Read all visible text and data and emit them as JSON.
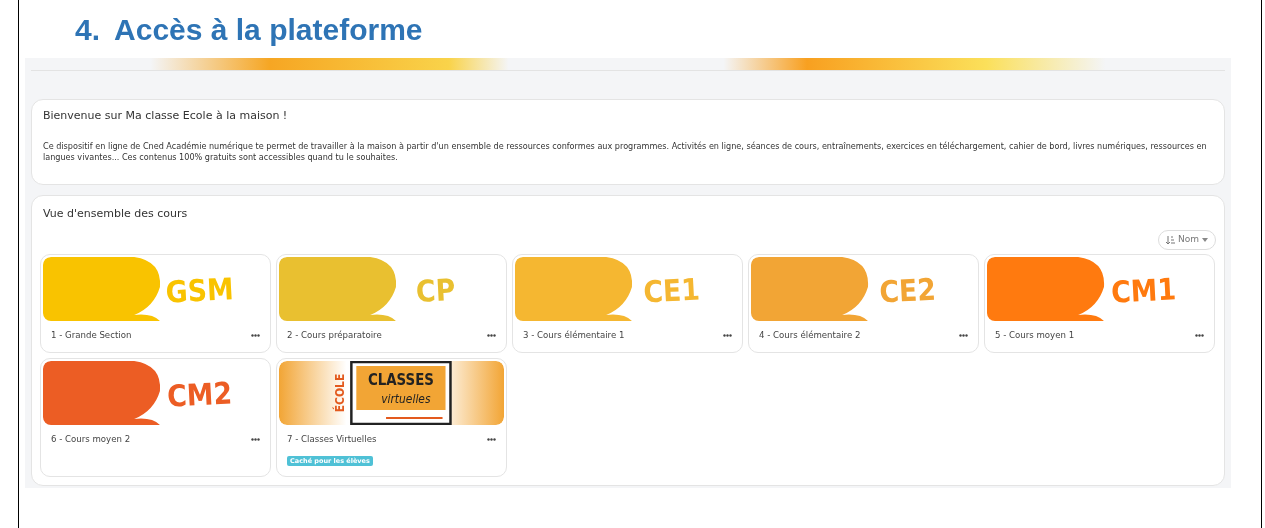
{
  "heading": {
    "number": "4.",
    "title": "Accès à la plateforme"
  },
  "welcome": {
    "title": "Bienvenue sur Ma classe Ecole à la maison !",
    "text": "Ce dispositif en ligne de Cned Académie numérique te permet de travailler à la maison à partir d'un ensemble de ressources conformes aux programmes. Activités en ligne, séances de cours, entraînements, exercices en téléchargement, cahier de bord, livres numériques, ressources en langues vivantes... Ces contenus 100% gratuits sont accessibles quand tu le souhaites."
  },
  "overview": {
    "title": "Vue d'ensemble des cours",
    "sort": {
      "label": "Nom"
    },
    "courses": [
      {
        "kind": "level",
        "banner": "GSM",
        "color": "#f9c300",
        "name": "1 - Grande Section",
        "hidden": false
      },
      {
        "kind": "level",
        "banner": "CP",
        "color": "#e9c030",
        "name": "2 - Cours préparatoire",
        "hidden": false
      },
      {
        "kind": "level",
        "banner": "CE1",
        "color": "#f5b731",
        "name": "3 - Cours élémentaire 1",
        "hidden": false
      },
      {
        "kind": "level",
        "banner": "CE2",
        "color": "#f2a535",
        "name": "4 - Cours élémentaire 2",
        "hidden": false
      },
      {
        "kind": "level",
        "banner": "CM1",
        "color": "#ff7a0f",
        "name": "5 - Cours moyen 1",
        "hidden": false
      },
      {
        "kind": "level",
        "banner": "CM2",
        "color": "#ec5d24",
        "name": "6 - Cours moyen 2",
        "hidden": false
      },
      {
        "kind": "virtual",
        "banner_side": "ÉCOLE",
        "banner_title": "CLASSES",
        "banner_subtitle": "virtuelles",
        "color": "#f2a535",
        "name": "7 - Classes Virtuelles",
        "hidden": true,
        "hidden_label": "Caché pour les élèves"
      }
    ]
  }
}
